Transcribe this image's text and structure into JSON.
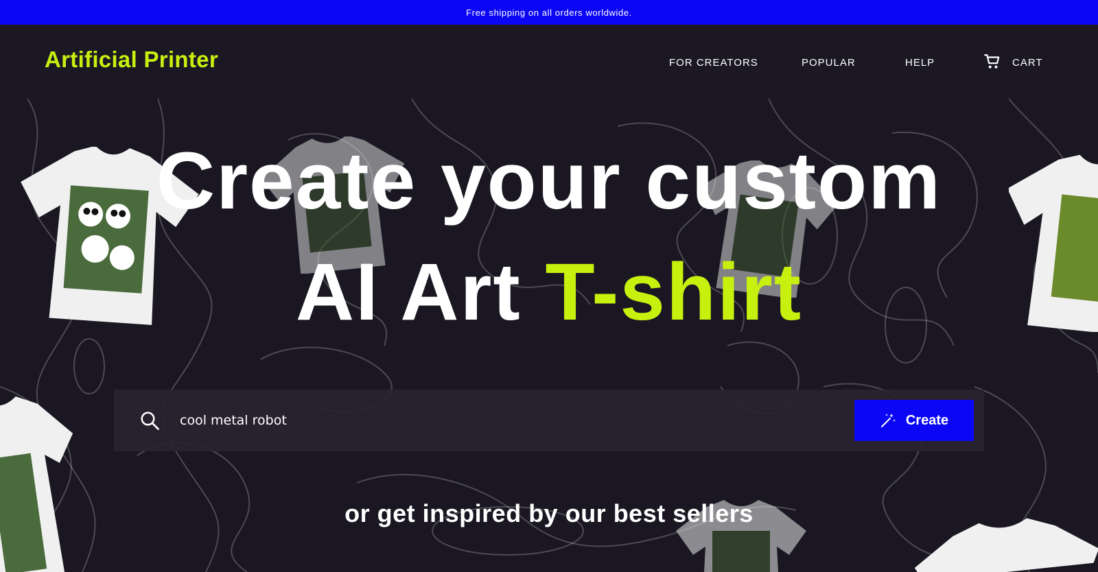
{
  "announcement": {
    "text": "Free shipping on all orders worldwide."
  },
  "header": {
    "logo": "Artificial Printer",
    "nav": {
      "for_creators": "FOR CREATORS",
      "popular": "POPULAR",
      "help": "HELP",
      "cart": "CART"
    }
  },
  "hero": {
    "headline_line1": "Create your custom",
    "headline_line2_plain": "AI Art",
    "headline_line2_accent": "T-shirt",
    "search": {
      "value": "cool metal robot",
      "icon": "search-icon"
    },
    "create_button": {
      "label": "Create",
      "icon": "magic-wand-icon"
    },
    "subtitle": "or get inspired by our best sellers"
  },
  "colors": {
    "brand_blue": "#0b07f5",
    "accent_lime": "#c8f00f",
    "background": "#1a1722"
  }
}
